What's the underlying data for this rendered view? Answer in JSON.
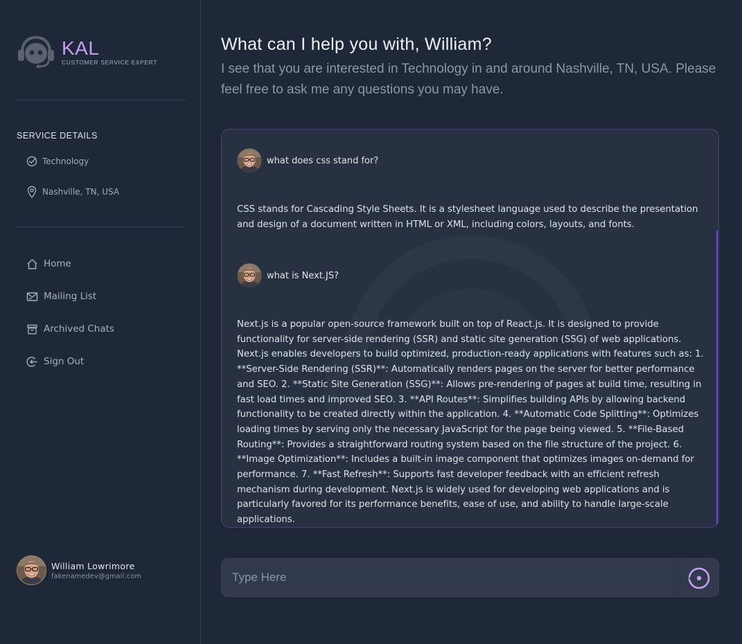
{
  "brand": {
    "name": "KAL",
    "tagline": "CUSTOMER SERVICE EXPERT",
    "logo_icon": "headset-bot-icon"
  },
  "sidebar": {
    "service_title": "SERVICE DETAILS",
    "details": [
      {
        "icon": "check-circle-icon",
        "label": "Technology"
      },
      {
        "icon": "map-pin-icon",
        "label": "Nashville, TN, USA"
      }
    ],
    "nav": [
      {
        "icon": "home-icon",
        "label": "Home"
      },
      {
        "icon": "mail-icon",
        "label": "Mailing List"
      },
      {
        "icon": "archive-icon",
        "label": "Archived Chats"
      },
      {
        "icon": "sign-out-icon",
        "label": "Sign Out"
      }
    ],
    "user": {
      "name": "William Lowrimore",
      "email": "fakenamedev@gmail.com"
    }
  },
  "main": {
    "greeting": "What can I help you with, William?",
    "intro": "I see that you are interested in Technology in and around Nashville, TN, USA. Please feel free to ask me any questions you may have.",
    "messages": [
      {
        "role": "user",
        "text": "what does css stand for?"
      },
      {
        "role": "assistant",
        "text": "CSS stands for Cascading Style Sheets. It is a stylesheet language used to describe the presentation and design of a document written in HTML or XML, including colors, layouts, and fonts."
      },
      {
        "role": "user",
        "text": "what is Next.JS?"
      },
      {
        "role": "assistant",
        "text": "Next.js is a popular open-source framework built on top of React.js. It is designed to provide functionality for server-side rendering (SSR) and static site generation (SSG) of web applications. Next.js enables developers to build optimized, production-ready applications with features such as: 1. **Server-Side Rendering (SSR)**: Automatically renders pages on the server for better performance and SEO. 2. **Static Site Generation (SSG)**: Allows pre-rendering of pages at build time, resulting in fast load times and improved SEO. 3. **API Routes**: Simplifies building APIs by allowing backend functionality to be created directly within the application. 4. **Automatic Code Splitting**: Optimizes loading times by serving only the necessary JavaScript for the page being viewed. 5. **File-Based Routing**: Provides a straightforward routing system based on the file structure of the project. 6. **Image Optimization**: Includes a built-in image component that optimizes images on-demand for performance. 7. **Fast Refresh**: Supports fast developer feedback with an efficient refresh mechanism during development. Next.js is widely used for developing web applications and is particularly favored for its performance benefits, ease of use, and ability to handle large-scale applications."
      }
    ],
    "input": {
      "placeholder": "Type Here",
      "value": ""
    },
    "send_icon": "send-circle-icon"
  },
  "colors": {
    "background": "#1e2838",
    "panel": "#283142",
    "accent": "#c79df0",
    "border_accent": "#4a3f7a"
  }
}
